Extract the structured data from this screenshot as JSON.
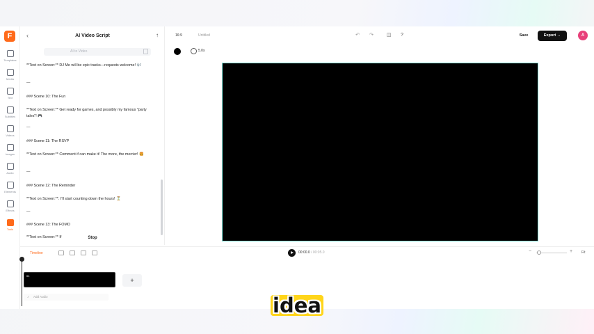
{
  "app": {
    "logo": "F",
    "accent": "#ff6a1a"
  },
  "nav": [
    {
      "label": "Templates",
      "icon": "templates-icon"
    },
    {
      "label": "Media",
      "icon": "media-icon"
    },
    {
      "label": "Text",
      "icon": "text-icon"
    },
    {
      "label": "Subtitles",
      "icon": "subtitles-icon"
    },
    {
      "label": "Videos",
      "icon": "videos-icon"
    },
    {
      "label": "Images",
      "icon": "images-icon"
    },
    {
      "label": "Audio",
      "icon": "audio-icon"
    },
    {
      "label": "Elements",
      "icon": "elements-icon"
    },
    {
      "label": "Effects",
      "icon": "effects-icon"
    },
    {
      "label": "Tools",
      "icon": "tools-icon",
      "active": true
    }
  ],
  "panel": {
    "title": "AI Video Script",
    "tab": "AI to Video",
    "script": [
      "**Text on Screen:** DJ Me will be epic tracks—requests welcome! 🎶",
      "—",
      "### Scene 10: The Fun",
      "**Text on Screen:** Get ready for games, and possibly my famous \"party tales\"! 🎮",
      "—",
      "### Scene 11: The RSVP",
      "**Text on Screen:** Comment if can make it! The more, the merrier! 🍔",
      "—",
      "### Scene 12: The Reminder",
      "**Text on Screen:**. I'll start counting down the hours! ⏳",
      "—",
      "### Scene 13: The FOMO",
      "**Text on Screen:** If"
    ],
    "stop_label": "Stop"
  },
  "topbar": {
    "aspect": "16:9",
    "project_name": "Untitled",
    "save_label": "Save",
    "export_label": "Export →",
    "avatar_initial": "A"
  },
  "canvas_bar": {
    "duration": "5.0s"
  },
  "timeline": {
    "label": "Timeline",
    "current_time": "00:00.0",
    "total_time": "/ 00:05.0",
    "zoom_fit": "Fit",
    "clip_label": "01",
    "add_audio": "Add Audio"
  },
  "caption": "idea"
}
